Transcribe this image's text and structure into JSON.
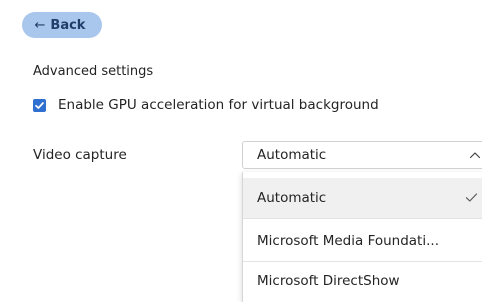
{
  "back_button": {
    "arrow": "←",
    "label": "Back"
  },
  "advanced_settings": {
    "title": "Advanced settings",
    "gpu_acceleration": {
      "label": "Enable GPU acceleration for virtual background",
      "checked": true
    }
  },
  "video_capture": {
    "label": "Video capture",
    "selected_value": "Automatic",
    "options": [
      "Automatic",
      "Microsoft Media Foundati...",
      "Microsoft DirectShow"
    ],
    "selected_index": 0
  },
  "colors": {
    "back_button_bg": "#a9c7ec",
    "checkbox_accent": "#2f6fd0",
    "selected_option_bg": "#f0f0f0"
  },
  "icons": {
    "back": "arrow-left-icon",
    "checkbox": "checkmark-icon",
    "dropdown": "chevron-up-icon",
    "selected": "checkmark-icon"
  }
}
